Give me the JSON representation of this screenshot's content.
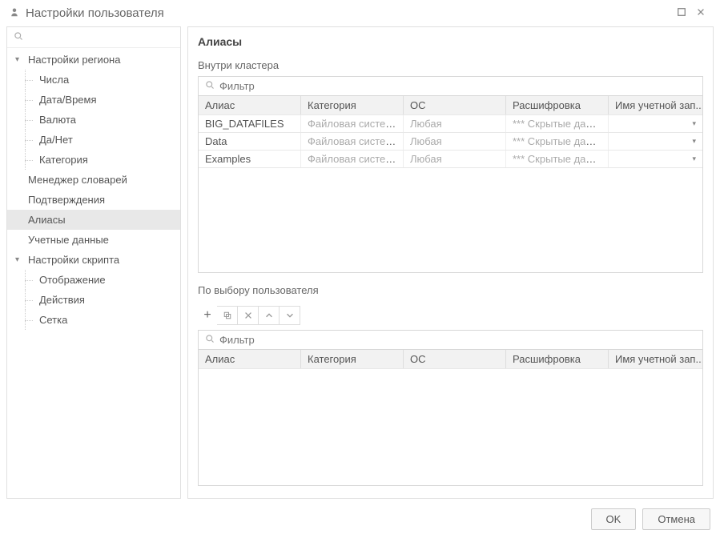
{
  "header": {
    "title": "Настройки пользователя",
    "icon": "user-icon"
  },
  "sidebar": {
    "search_placeholder": "",
    "groups": [
      {
        "label": "Настройки региона",
        "expanded": true,
        "children": [
          {
            "label": "Числа"
          },
          {
            "label": "Дата/Время"
          },
          {
            "label": "Валюта"
          },
          {
            "label": "Да/Нет"
          },
          {
            "label": "Категория"
          }
        ]
      },
      {
        "label": "Менеджер словарей",
        "nochild": true
      },
      {
        "label": "Подтверждения",
        "nochild": true
      },
      {
        "label": "Алиасы",
        "nochild": true,
        "selected": true
      },
      {
        "label": "Учетные данные",
        "nochild": true
      },
      {
        "label": "Настройки скрипта",
        "expanded": true,
        "children": [
          {
            "label": "Отображение"
          },
          {
            "label": "Действия"
          },
          {
            "label": "Сетка"
          }
        ]
      }
    ]
  },
  "main": {
    "title": "Алиасы",
    "section1": {
      "label": "Внутри кластера",
      "filter_placeholder": "Фильтр",
      "columns": [
        "Алиас",
        "Категория",
        "ОС",
        "Расшифровка",
        "Имя учетной зап..."
      ],
      "rows": [
        {
          "alias": "BIG_DATAFILES",
          "category": "Файловая система",
          "os": "Любая",
          "value": "*** Скрытые данны"
        },
        {
          "alias": "Data",
          "category": "Файловая система",
          "os": "Любая",
          "value": "*** Скрытые данны"
        },
        {
          "alias": "Examples",
          "category": "Файловая система",
          "os": "Любая",
          "value": "*** Скрытые данны"
        }
      ]
    },
    "section2": {
      "label": "По выбору пользователя",
      "toolbar": [
        "add",
        "copy",
        "delete",
        "up",
        "down"
      ],
      "filter_placeholder": "Фильтр",
      "columns": [
        "Алиас",
        "Категория",
        "ОС",
        "Расшифровка",
        "Имя учетной зап..."
      ],
      "rows": []
    }
  },
  "footer": {
    "ok": "OK",
    "cancel": "Отмена"
  }
}
